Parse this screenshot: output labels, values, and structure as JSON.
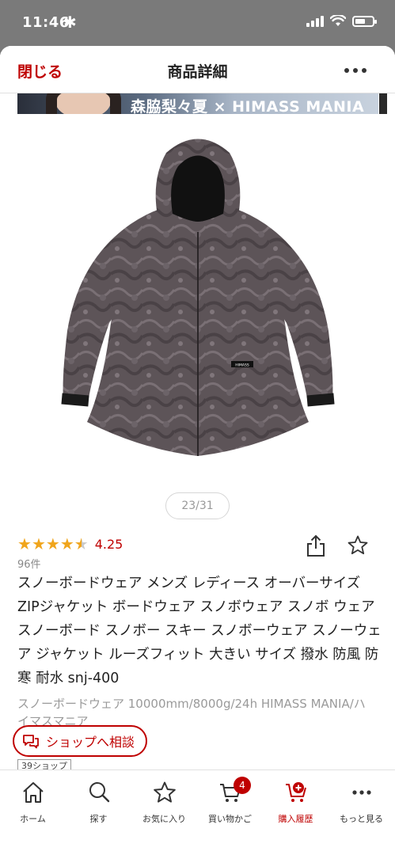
{
  "status_bar": {
    "time": "11:46",
    "activity_icon": "asterisk-icon",
    "battery_level": 0.6
  },
  "nav": {
    "close_label": "閉じる",
    "title": "商品詳細",
    "more_icon": "more-dots-icon"
  },
  "banner": {
    "text": "森脇梨々夏 × HIMASS MANIA"
  },
  "gallery": {
    "counter": "23/31"
  },
  "rating": {
    "value": "4.25",
    "stars": 4.25,
    "max": 5,
    "count": "96件"
  },
  "actions": {
    "share_icon": "share-icon",
    "favorite_icon": "star-outline-icon"
  },
  "product": {
    "title": "スノーボードウェア メンズ レディース オーバーサイズ ZIPジャケット ボードウェア スノボウェア スノボ ウェア スノーボード スノボー スキー スノボーウェア スノーウェア ジャケット ルーズフィット 大きい サイズ 撥水 防風 防寒 耐水 snj-400",
    "subtitle": "スノーボードウェア 10000mm/8000g/24h HIMASS MANIA/ハイマスマニア",
    "jacket_label": "HIMASS"
  },
  "shop": {
    "consult_label": "ショップへ相談",
    "tag": "39ショップ"
  },
  "tabbar": {
    "tabs": [
      {
        "label": "ホーム",
        "icon": "home-icon"
      },
      {
        "label": "探す",
        "icon": "search-icon"
      },
      {
        "label": "お気に入り",
        "icon": "star-icon"
      },
      {
        "label": "買い物かご",
        "icon": "cart-icon",
        "badge": "4"
      },
      {
        "label": "購入履歴",
        "icon": "history-cart-icon",
        "active": true
      },
      {
        "label": "もっと見る",
        "icon": "more-icon"
      }
    ]
  },
  "colors": {
    "accent": "#bf0000",
    "star": "#f0a51c",
    "status_bg": "#7a7a7a"
  }
}
